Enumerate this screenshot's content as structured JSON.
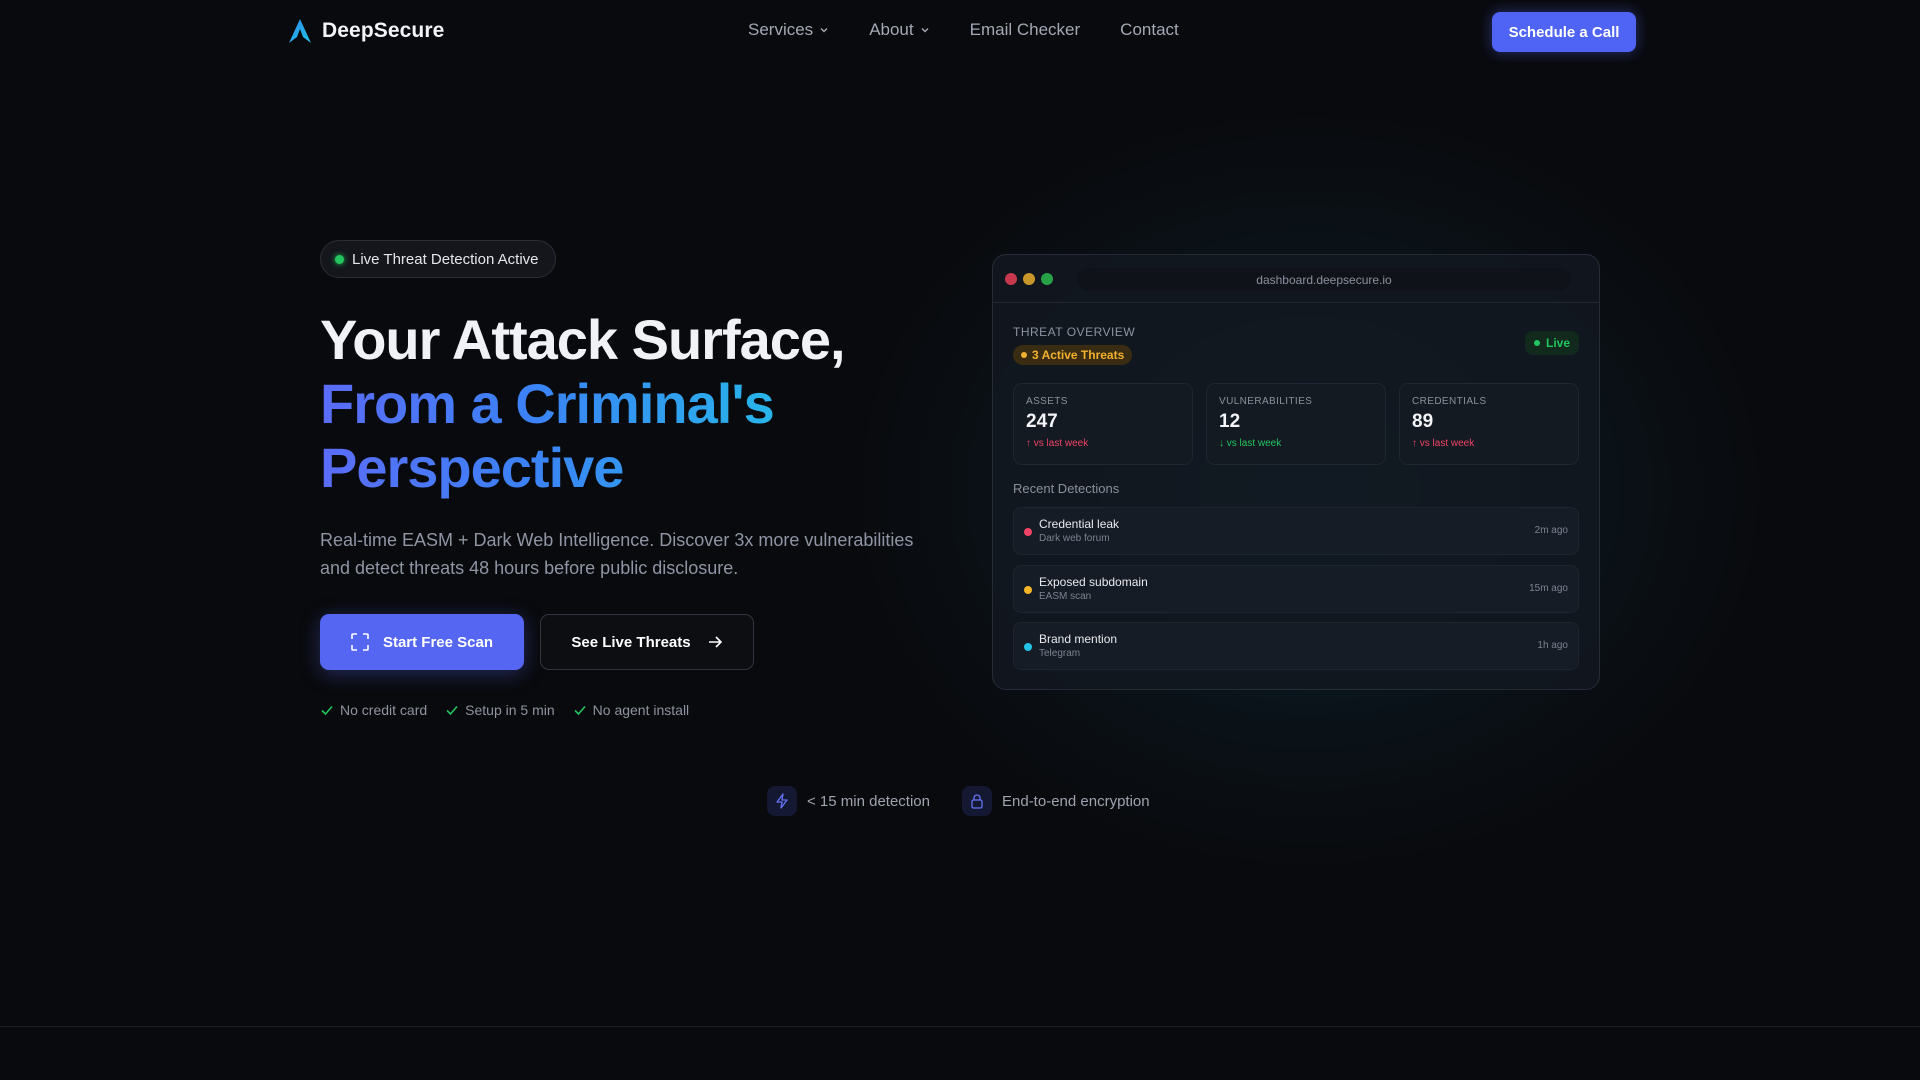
{
  "brand": {
    "name": "DeepSecure"
  },
  "nav": {
    "items": [
      {
        "label": "Services",
        "has_dropdown": true
      },
      {
        "label": "About",
        "has_dropdown": true
      },
      {
        "label": "Email Checker",
        "has_dropdown": false
      },
      {
        "label": "Contact",
        "has_dropdown": false
      }
    ],
    "cta_label": "Schedule a Call"
  },
  "hero": {
    "badge": "Live Threat Detection Active",
    "title_line1": "Your Attack Surface,",
    "title_line2": "From a Criminal's",
    "title_line3": "Perspective",
    "subtitle": "Real-time EASM + Dark Web Intelligence. Discover 3x more vulnerabilities and detect threats 48 hours before public disclosure.",
    "primary_cta": "Start Free Scan",
    "secondary_cta": "See Live Threats",
    "checks": [
      "No credit card",
      "Setup in 5 min",
      "No agent install"
    ]
  },
  "dashboard": {
    "url": "dashboard.deepsecure.io",
    "section_title": "THREAT OVERVIEW",
    "threat_badge": "3 Active Threats",
    "live_label": "Live",
    "stats": [
      {
        "label": "ASSETS",
        "value": "247",
        "trend": "↑ vs last week",
        "trend_color": "#ef4466"
      },
      {
        "label": "VULNERABILITIES",
        "value": "12",
        "trend": "↓ vs last week",
        "trend_color": "#22c55e"
      },
      {
        "label": "CREDENTIALS",
        "value": "89",
        "trend": "↑ vs last week",
        "trend_color": "#ef4466"
      }
    ],
    "recent_title": "Recent Detections",
    "detections": [
      {
        "name": "Credential leak",
        "source": "Dark web forum",
        "time": "2m ago",
        "color": "#ef4466"
      },
      {
        "name": "Exposed subdomain",
        "source": "EASM scan",
        "time": "15m ago",
        "color": "#f5b428"
      },
      {
        "name": "Brand mention",
        "source": "Telegram",
        "time": "1h ago",
        "color": "#22c3e6"
      }
    ]
  },
  "features": [
    {
      "icon": "lightning-icon",
      "label": "< 15 min detection"
    },
    {
      "icon": "lock-icon",
      "label": "End-to-end encryption"
    }
  ],
  "colors": {
    "accent": "#4f63f5",
    "live_green": "#22c55e",
    "warning_amber": "#f1b12e",
    "alert_red": "#ef4466"
  }
}
